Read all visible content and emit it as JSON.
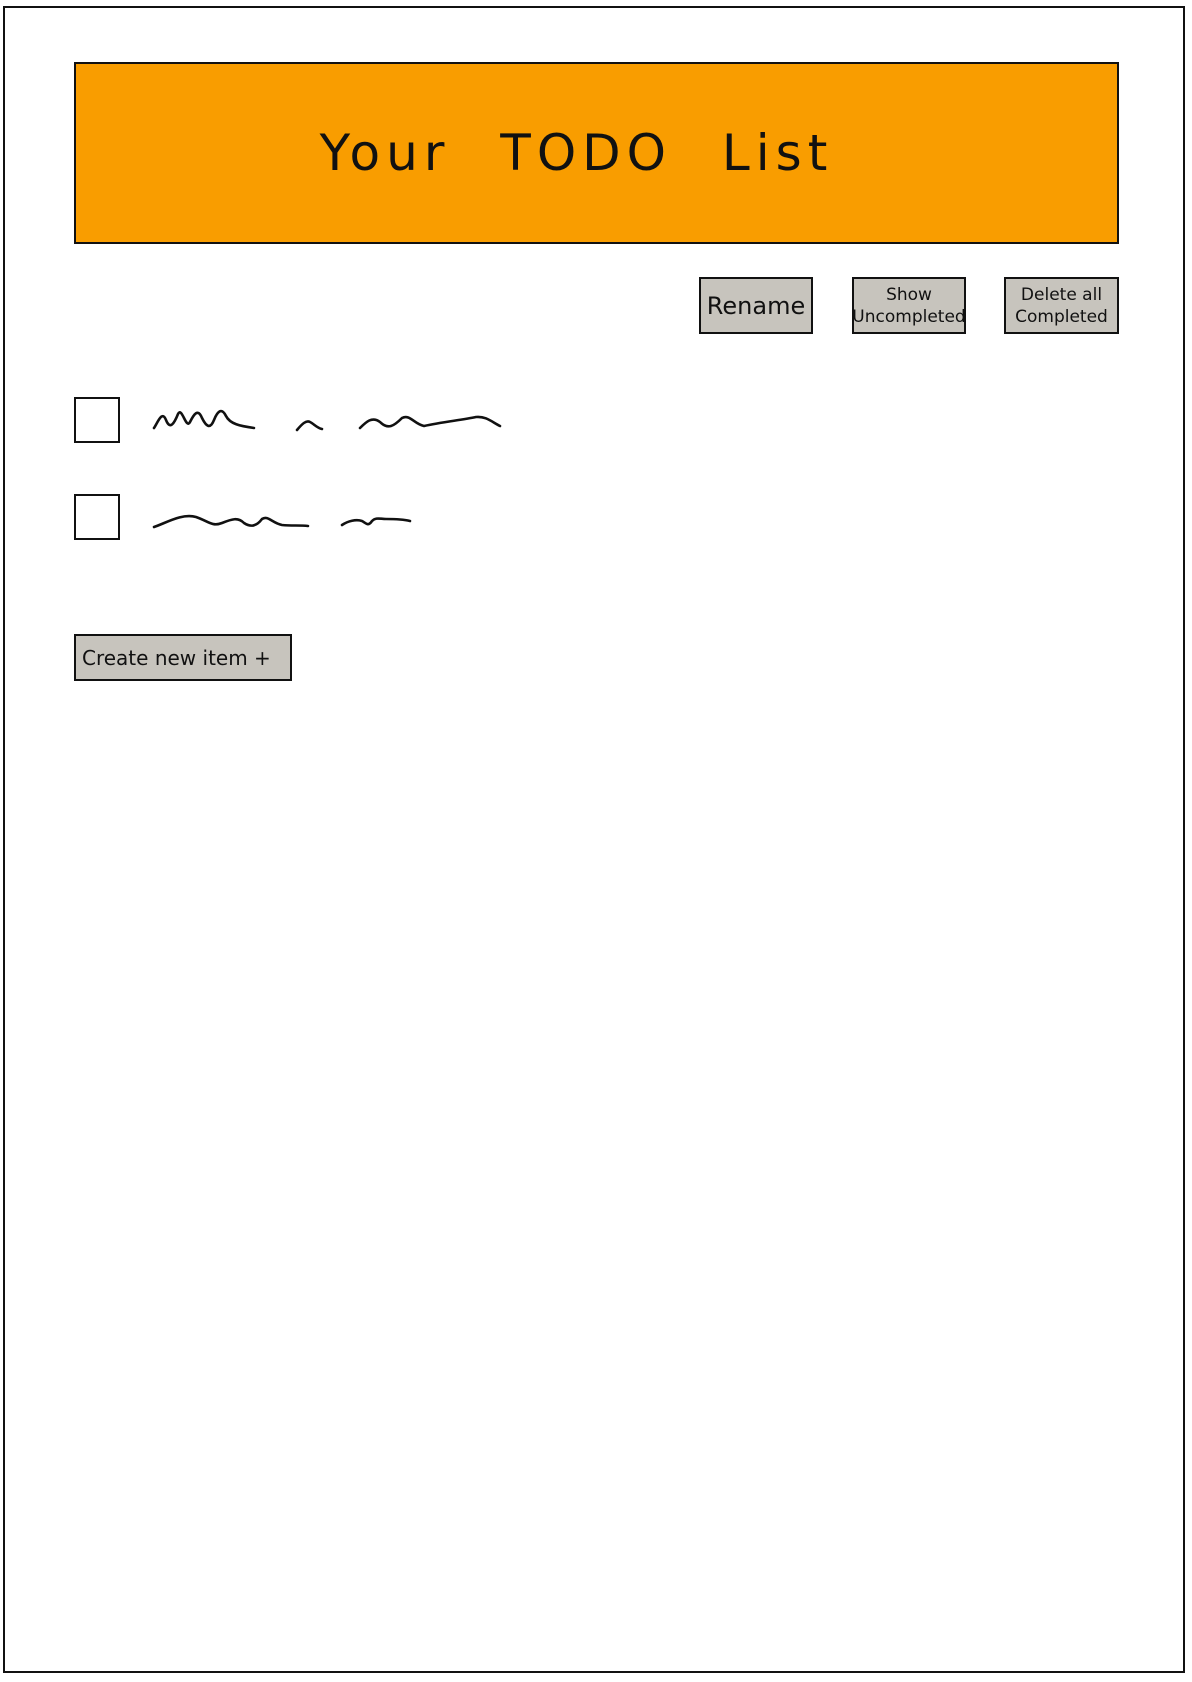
{
  "header": {
    "title": "Your TODO List"
  },
  "toolbar": {
    "rename_label": "Rename",
    "show_uncompleted_label_line1": "Show",
    "show_uncompleted_label_line2": "Uncompleted",
    "delete_completed_label_line1": "Delete all",
    "delete_completed_label_line2": "Completed"
  },
  "todo_list": {
    "items": [
      {
        "completed": false
      },
      {
        "completed": false
      }
    ]
  },
  "actions": {
    "create_label": "Create new item +"
  },
  "colors": {
    "header_background": "#f99d00",
    "button_background": "#c7c4bd",
    "outline": "#111111",
    "page_background": "#ffffff"
  }
}
